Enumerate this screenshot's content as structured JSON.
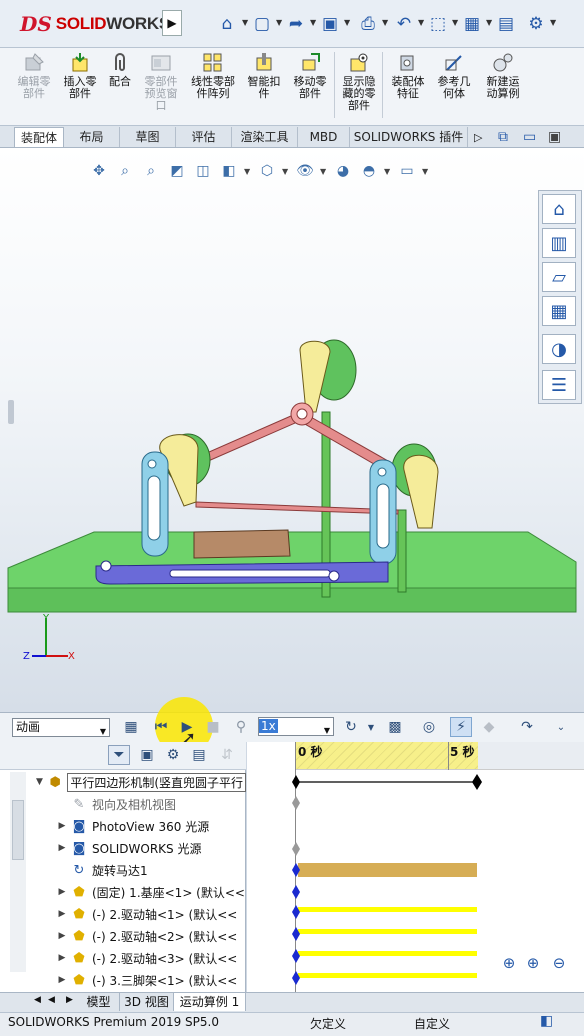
{
  "app": {
    "brand_prefix": "SOLID",
    "brand_suffix": "WORKS"
  },
  "quickaccess": {
    "items": [
      "home-icon",
      "new-document-icon",
      "open-icon",
      "save-icon",
      "print-icon",
      "undo-icon",
      "select-icon"
    ]
  },
  "commands": [
    {
      "label1": "编辑零",
      "label2": "部件",
      "enabled": false
    },
    {
      "label1": "插入零",
      "label2": "部件",
      "enabled": true
    },
    {
      "label1": "配合",
      "label2": "",
      "enabled": true
    },
    {
      "label1": "零部件",
      "label2": "预览窗",
      "label3": "口",
      "enabled": false
    },
    {
      "label1": "线性零部",
      "label2": "件阵列",
      "enabled": true
    },
    {
      "label1": "智能扣",
      "label2": "件",
      "enabled": true
    },
    {
      "label1": "移动零",
      "label2": "部件",
      "enabled": true
    },
    {
      "label1": "显示隐",
      "label2": "藏的零",
      "label3": "部件",
      "enabled": true
    },
    {
      "label1": "装配体",
      "label2": "特征",
      "enabled": true
    },
    {
      "label1": "参考几",
      "label2": "何体",
      "enabled": true
    },
    {
      "label1": "新建运",
      "label2": "动算例",
      "enabled": true
    }
  ],
  "tabs": [
    "装配体",
    "布局",
    "草图",
    "评估",
    "渲染工具",
    "MBD",
    "SOLIDWORKS 插件"
  ],
  "animation": {
    "study_type": "动画",
    "playback_speed": "1x"
  },
  "tree": {
    "root": "平行四边形机制(竖直兜圆子平行",
    "items": [
      {
        "label": "视向及相机视图",
        "has_children": false,
        "dim": true
      },
      {
        "label": "PhotoView 360 光源",
        "has_children": true
      },
      {
        "label": "SOLIDWORKS 光源",
        "has_children": true
      },
      {
        "label": "旋转马达1",
        "has_children": false
      },
      {
        "label": "(固定) 1.基座<1> (默认<<",
        "has_children": true
      },
      {
        "label": "(-) 2.驱动轴<1> (默认<<",
        "has_children": true
      },
      {
        "label": "(-) 2.驱动轴<2> (默认<<",
        "has_children": true
      },
      {
        "label": "(-) 2.驱动轴<3> (默认<<",
        "has_children": true
      },
      {
        "label": "(-) 3.三脚架<1> (默认<<",
        "has_children": true
      }
    ]
  },
  "timeline": {
    "tick_start": "0 秒",
    "tick_end": "5 秒"
  },
  "bottom_tabs": [
    "模型",
    "3D 视图",
    "运动算例 1"
  ],
  "status": {
    "version": "SOLIDWORKS Premium 2019 SP5.0",
    "state": "欠定义",
    "units": "自定义"
  },
  "colors": {
    "accent": "#2559a8",
    "timeline_band": "#f7f08a",
    "motor_bar": "#d6ad55",
    "part_bar": "#ffff00",
    "floor": "#6ed36a"
  }
}
